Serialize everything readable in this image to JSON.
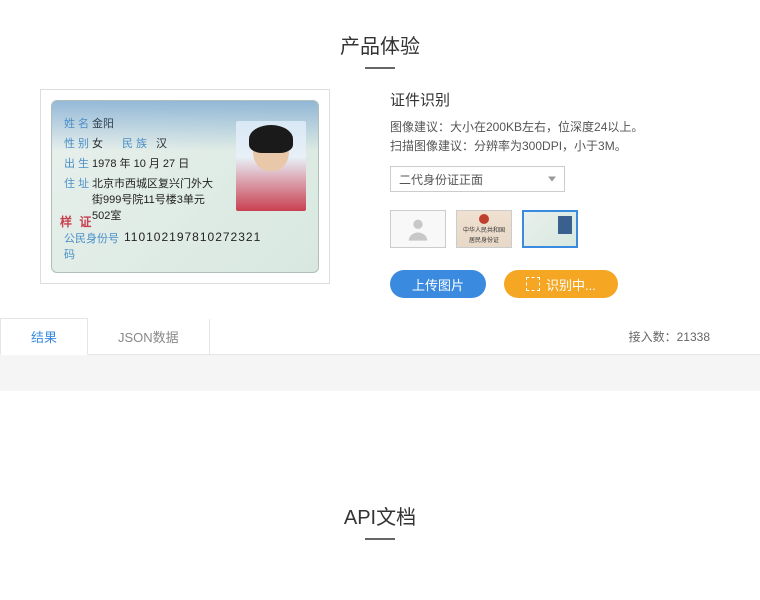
{
  "sections": {
    "demo_title": "产品体验",
    "api_title": "API文档"
  },
  "id_card": {
    "name_label": "姓 名",
    "name": "金阳",
    "sex_label": "性 别",
    "sex": "女",
    "ethnic_label": "民 族",
    "ethnic": "汉",
    "birth_label": "出 生",
    "birth": "1978 年 10 月 27 日",
    "addr_label": "住 址",
    "addr1": "北京市西城区复兴门外大",
    "addr2": "街999号院11号楼3单元",
    "addr3": "502室",
    "stamp": "样 证",
    "idnum_label": "公民身份号码",
    "idnum": "110102197810272321"
  },
  "panel": {
    "title": "证件识别",
    "hint1": "图像建议：大小在200KB左右，位深度24以上。",
    "hint2": "扫描图像建议：分辨率为300DPI，小于3M。",
    "select_value": "二代身份证正面",
    "upload_btn": "上传图片",
    "recognize_btn": "识别中..."
  },
  "tabs": {
    "result": "结果",
    "json": "JSON数据"
  },
  "access": {
    "label": "接入数：",
    "count": "21338"
  }
}
